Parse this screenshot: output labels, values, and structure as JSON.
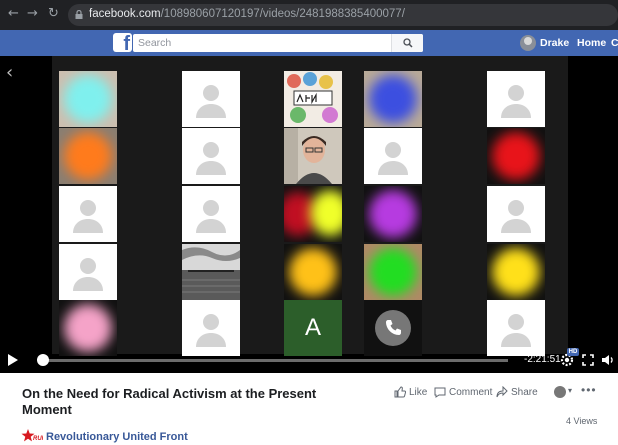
{
  "browser": {
    "url_domain": "facebook.com",
    "url_path": "/108980607120197/videos/2481988385400077/"
  },
  "fb_header": {
    "search_placeholder": "Search",
    "user_name": "Drake",
    "home_label": "Home",
    "more_label": "C"
  },
  "player": {
    "time_remaining": "-2:21:51",
    "hd_label": "HD",
    "progress_fraction": 0.01,
    "tiles": [
      {
        "kind": "blurred",
        "spot_color": "#7ff0ee",
        "bg": "#cdbfb0"
      },
      {
        "kind": "placeholder"
      },
      {
        "kind": "image-drawing",
        "bg": "#f2ece4"
      },
      {
        "kind": "blurred",
        "spot_color": "#3c4fe0",
        "bg": "#b9aa98"
      },
      {
        "kind": "placeholder"
      },
      {
        "kind": "blurred",
        "spot_color": "#ff7b1c",
        "bg": "#8a7e72"
      },
      {
        "kind": "placeholder"
      },
      {
        "kind": "webcam-person",
        "bg": "#c9c3b8"
      },
      {
        "kind": "placeholder"
      },
      {
        "kind": "blurred",
        "spot_color": "#e8141a",
        "bg": "#111111"
      },
      {
        "kind": "placeholder"
      },
      {
        "kind": "placeholder"
      },
      {
        "kind": "blurred-pair",
        "spot_color": "#c00f22",
        "spot_color_2": "#f0ff2a",
        "bg": "#111111"
      },
      {
        "kind": "blurred",
        "spot_color": "#b63be0",
        "bg": "#111111"
      },
      {
        "kind": "placeholder"
      },
      {
        "kind": "placeholder"
      },
      {
        "kind": "image-pier",
        "bg": "#9a9a9a"
      },
      {
        "kind": "blurred",
        "spot_color": "#ffc118",
        "bg": "#111111"
      },
      {
        "kind": "blurred",
        "spot_color": "#22dd22",
        "bg": "#b08a66"
      },
      {
        "kind": "blurred",
        "spot_color": "#ffe01a",
        "bg": "#111111"
      },
      {
        "kind": "blurred",
        "spot_color": "#f5a3c8",
        "bg": "#111111"
      },
      {
        "kind": "placeholder"
      },
      {
        "kind": "letter",
        "letter": "A"
      },
      {
        "kind": "phone"
      },
      {
        "kind": "placeholder"
      }
    ]
  },
  "video": {
    "title": "On the Need for Radical Activism at the Present Moment",
    "like_label": "Like",
    "comment_label": "Comment",
    "share_label": "Share",
    "views": "4 Views",
    "page_name": "Revolutionary United Front"
  },
  "colors": {
    "fb_blue": "#4267b2",
    "link_blue": "#385898",
    "logo_red": "#d71920"
  }
}
